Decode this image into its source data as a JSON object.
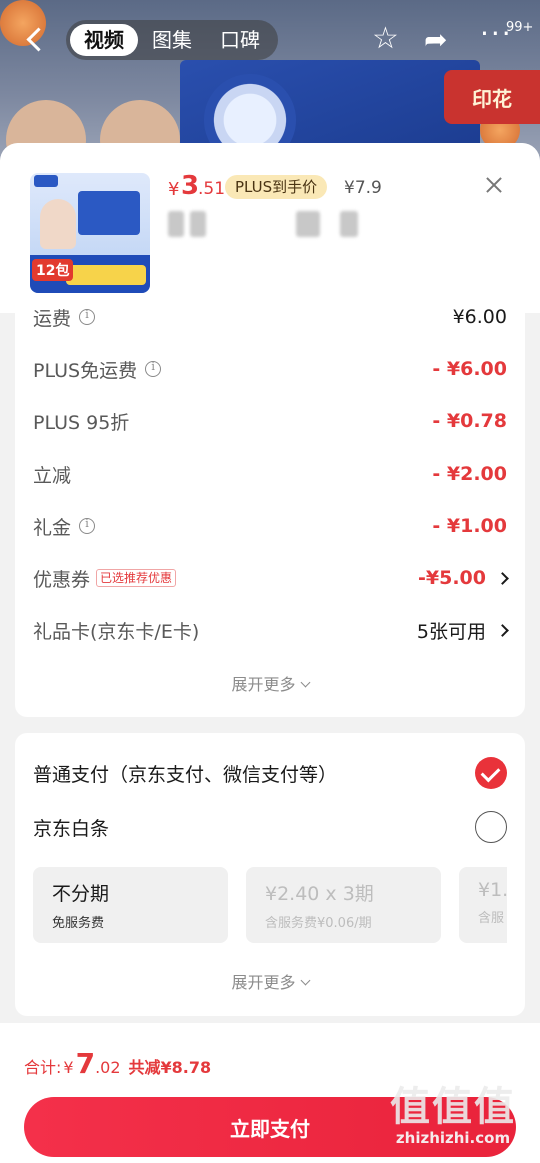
{
  "topbar": {
    "tabs": [
      "视频",
      "图集",
      "口碑"
    ],
    "active_tab": 0,
    "badge": "99+",
    "banner_stamp": "印花"
  },
  "product": {
    "price_symbol": "¥",
    "price_int": "3",
    "price_dec": ".51",
    "plus_tag": "PLUS到手价",
    "original_price": "¥7.9",
    "thumb_pack_label": "12包"
  },
  "costs": {
    "rows": [
      {
        "label": "运费",
        "value": "¥6.00",
        "info": true
      },
      {
        "label": "PLUS免运费",
        "value": "- ¥6.00",
        "info": true
      },
      {
        "label": "PLUS 95折",
        "value": "- ¥0.78",
        "info": false
      },
      {
        "label": "立减",
        "value": "- ¥2.00",
        "info": false
      },
      {
        "label": "礼金",
        "value": "- ¥1.00",
        "info": true
      }
    ],
    "coupon": {
      "label": "优惠券",
      "tag": "已选推荐优惠",
      "value": "-¥5.00"
    },
    "giftcard": {
      "label": "礼品卡(京东卡/E卡)",
      "value": "5张可用"
    },
    "expand_label": "展开更多"
  },
  "payment": {
    "standard": {
      "label": "普通支付（京东支付、微信支付等）",
      "checked": true
    },
    "baitiao": {
      "label": "京东白条",
      "checked": false
    },
    "installments": [
      {
        "title": "不分期",
        "sub": "免服务费",
        "enabled": true
      },
      {
        "title": "¥2.40 x 3期",
        "sub": "含服务费¥0.06/期",
        "enabled": false
      },
      {
        "title": "¥1.",
        "sub": "含服",
        "enabled": false
      }
    ],
    "expand_label": "展开更多"
  },
  "footer": {
    "total_label": "合计:",
    "currency": "¥",
    "total_int": "7",
    "total_dec": ".02",
    "saved": "共减¥8.78",
    "pay_button": "立即支付"
  },
  "watermark": {
    "glyphs": "值值值",
    "domain": "zhizhizhi.com"
  },
  "colors": {
    "accent": "#e4393c",
    "plus_tag_bg": "#fae8b6",
    "pay_button": "#ef2a42"
  }
}
